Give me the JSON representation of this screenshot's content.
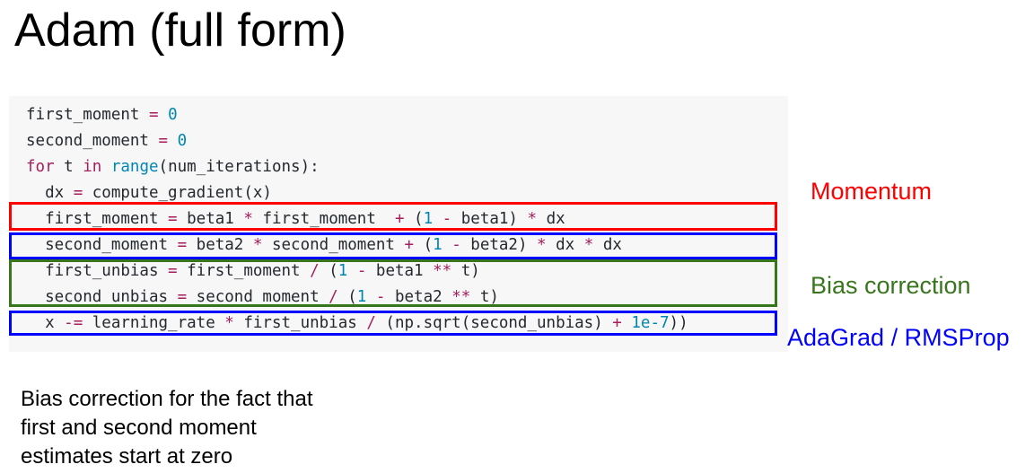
{
  "slide": {
    "title": "Adam (full form)"
  },
  "colors": {
    "code_background": "#f7f7f8",
    "text": "#24292e",
    "keyword": "#a71d5d",
    "operator": "#a71d5d",
    "number": "#0086b3",
    "builtin": "#0086b3",
    "momentum": "#ff0000",
    "bias_correction": "#38761d",
    "adagrad": "#0000ff"
  },
  "code": {
    "lines": [
      [
        {
          "t": "first_moment ",
          "k": "plain"
        },
        {
          "t": "=",
          "k": "op"
        },
        {
          "t": " ",
          "k": "plain"
        },
        {
          "t": "0",
          "k": "num"
        }
      ],
      [
        {
          "t": "second_moment ",
          "k": "plain"
        },
        {
          "t": "=",
          "k": "op"
        },
        {
          "t": " ",
          "k": "plain"
        },
        {
          "t": "0",
          "k": "num"
        }
      ],
      [
        {
          "t": "for",
          "k": "kw"
        },
        {
          "t": " t ",
          "k": "plain"
        },
        {
          "t": "in",
          "k": "kw"
        },
        {
          "t": " ",
          "k": "plain"
        },
        {
          "t": "range",
          "k": "builtin"
        },
        {
          "t": "(num_iterations):",
          "k": "plain"
        }
      ],
      [
        {
          "t": "  dx ",
          "k": "plain"
        },
        {
          "t": "=",
          "k": "op"
        },
        {
          "t": " compute_gradient(x)",
          "k": "plain"
        }
      ],
      [
        {
          "t": "  first_moment ",
          "k": "plain"
        },
        {
          "t": "=",
          "k": "op"
        },
        {
          "t": " beta1 ",
          "k": "plain"
        },
        {
          "t": "*",
          "k": "op"
        },
        {
          "t": " first_moment  ",
          "k": "plain"
        },
        {
          "t": "+",
          "k": "op"
        },
        {
          "t": " (",
          "k": "plain"
        },
        {
          "t": "1",
          "k": "num"
        },
        {
          "t": " ",
          "k": "plain"
        },
        {
          "t": "-",
          "k": "op"
        },
        {
          "t": " beta1) ",
          "k": "plain"
        },
        {
          "t": "*",
          "k": "op"
        },
        {
          "t": " dx",
          "k": "plain"
        }
      ],
      [
        {
          "t": "  second_moment ",
          "k": "plain"
        },
        {
          "t": "=",
          "k": "op"
        },
        {
          "t": " beta2 ",
          "k": "plain"
        },
        {
          "t": "*",
          "k": "op"
        },
        {
          "t": " second_moment ",
          "k": "plain"
        },
        {
          "t": "+",
          "k": "op"
        },
        {
          "t": " (",
          "k": "plain"
        },
        {
          "t": "1",
          "k": "num"
        },
        {
          "t": " ",
          "k": "plain"
        },
        {
          "t": "-",
          "k": "op"
        },
        {
          "t": " beta2) ",
          "k": "plain"
        },
        {
          "t": "*",
          "k": "op"
        },
        {
          "t": " dx ",
          "k": "plain"
        },
        {
          "t": "*",
          "k": "op"
        },
        {
          "t": " dx",
          "k": "plain"
        }
      ],
      [
        {
          "t": "  first_unbias ",
          "k": "plain"
        },
        {
          "t": "=",
          "k": "op"
        },
        {
          "t": " first_moment ",
          "k": "plain"
        },
        {
          "t": "/",
          "k": "op"
        },
        {
          "t": " (",
          "k": "plain"
        },
        {
          "t": "1",
          "k": "num"
        },
        {
          "t": " ",
          "k": "plain"
        },
        {
          "t": "-",
          "k": "op"
        },
        {
          "t": " beta1 ",
          "k": "plain"
        },
        {
          "t": "**",
          "k": "op"
        },
        {
          "t": " t)",
          "k": "plain"
        }
      ],
      [
        {
          "t": "  second_unbias ",
          "k": "plain"
        },
        {
          "t": "=",
          "k": "op"
        },
        {
          "t": " second_moment ",
          "k": "plain"
        },
        {
          "t": "/",
          "k": "op"
        },
        {
          "t": " (",
          "k": "plain"
        },
        {
          "t": "1",
          "k": "num"
        },
        {
          "t": " ",
          "k": "plain"
        },
        {
          "t": "-",
          "k": "op"
        },
        {
          "t": " beta2 ",
          "k": "plain"
        },
        {
          "t": "**",
          "k": "op"
        },
        {
          "t": " t)",
          "k": "plain"
        }
      ],
      [
        {
          "t": "  x ",
          "k": "plain"
        },
        {
          "t": "-=",
          "k": "op"
        },
        {
          "t": " learning_rate ",
          "k": "plain"
        },
        {
          "t": "*",
          "k": "op"
        },
        {
          "t": " first_unbias ",
          "k": "plain"
        },
        {
          "t": "/",
          "k": "op"
        },
        {
          "t": " (np.sqrt(second_unbias) ",
          "k": "plain"
        },
        {
          "t": "+",
          "k": "op"
        },
        {
          "t": " ",
          "k": "plain"
        },
        {
          "t": "1e-7",
          "k": "num"
        },
        {
          "t": "))",
          "k": "plain"
        }
      ]
    ]
  },
  "annotations": {
    "momentum": "Momentum",
    "bias_correction": "Bias correction",
    "adagrad_rmsprop": "AdaGrad / RMSProp"
  },
  "footnote": {
    "lines": [
      "Bias correction for the fact that",
      "first and second moment",
      "estimates start at zero"
    ]
  }
}
